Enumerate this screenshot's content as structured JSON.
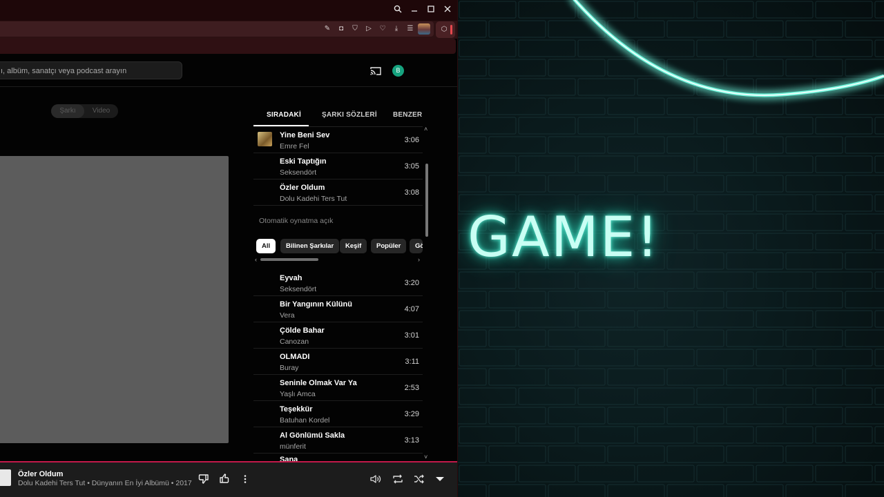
{
  "window_controls": [
    "search-icon",
    "minimize-icon",
    "maximize-icon",
    "close-icon"
  ],
  "search": {
    "placeholder": "ı, albüm, sanatçı veya podcast arayın"
  },
  "profile": {
    "initial": "B",
    "color": "#16a37f"
  },
  "mode_toggle": {
    "song": "Şarkı",
    "video": "Video"
  },
  "tabs": [
    {
      "label": "SIRADAKİ",
      "active": true
    },
    {
      "label": "ŞARKI SÖZLERİ",
      "active": false
    },
    {
      "label": "BENZER",
      "active": false
    }
  ],
  "queue": [
    {
      "title": "Yine Beni Sev",
      "artist": "Emre Fel",
      "duration": "3:06"
    },
    {
      "title": "Eski Taptığın",
      "artist": "Seksendört",
      "duration": "3:05"
    },
    {
      "title": "Özler Oldum",
      "artist": "Dolu Kadehi Ters Tut",
      "duration": "3:08"
    }
  ],
  "autoplay_label": "Otomatik oynatma açık",
  "chips": [
    "All",
    "Bilinen Şarkılar",
    "Keşif",
    "Popüler",
    "Gö"
  ],
  "autoplay_queue": [
    {
      "title": "Eyvah",
      "artist": "Seksendört",
      "duration": "3:20"
    },
    {
      "title": "Bir Yangının Külünü",
      "artist": "Vera",
      "duration": "4:07"
    },
    {
      "title": "Çölde Bahar",
      "artist": "Canozan",
      "duration": "3:01"
    },
    {
      "title": "OLMADI",
      "artist": "Buray",
      "duration": "3:11"
    },
    {
      "title": "Seninle Olmak Var Ya",
      "artist": "Yaşlı Amca",
      "duration": "2:53"
    },
    {
      "title": "Teşekkür",
      "artist": "Batuhan Kordel",
      "duration": "3:29"
    },
    {
      "title": "Al Gönlümü Sakla",
      "artist": "münferit",
      "duration": "3:13"
    },
    {
      "title": "Sana",
      "artist": "",
      "duration": ""
    }
  ],
  "player": {
    "title": "Özler Oldum",
    "subtitle": "Dolu Kadehi Ters Tut • Dünyanın En İyi Albümü • 2017",
    "accent": "#c4194a"
  },
  "wallpaper": {
    "text": "GAME!",
    "neon_color": "#3fe6c8"
  }
}
